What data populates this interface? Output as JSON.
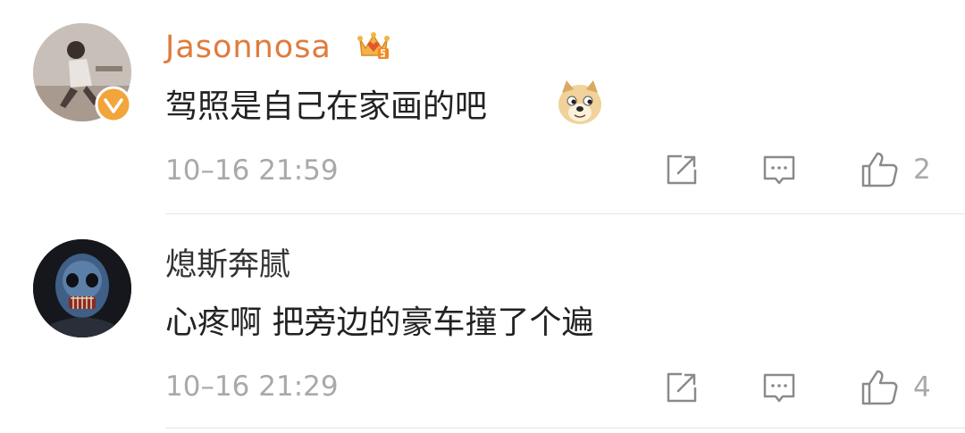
{
  "comments": [
    {
      "username": "Jasonnosa",
      "username_color": "#e07b3c",
      "verified": true,
      "badge_icon": "crown-level-icon",
      "text": "驾照是自己在家画的吧",
      "emoji": "doge-emoji-icon",
      "time": "10–16 21:59",
      "likes": "2"
    },
    {
      "username": "熄斯奔腻",
      "username_color": "#333333",
      "verified": false,
      "text": "心疼啊 把旁边的豪车撞了个遍",
      "time": "10–16 21:29",
      "likes": "4"
    }
  ]
}
